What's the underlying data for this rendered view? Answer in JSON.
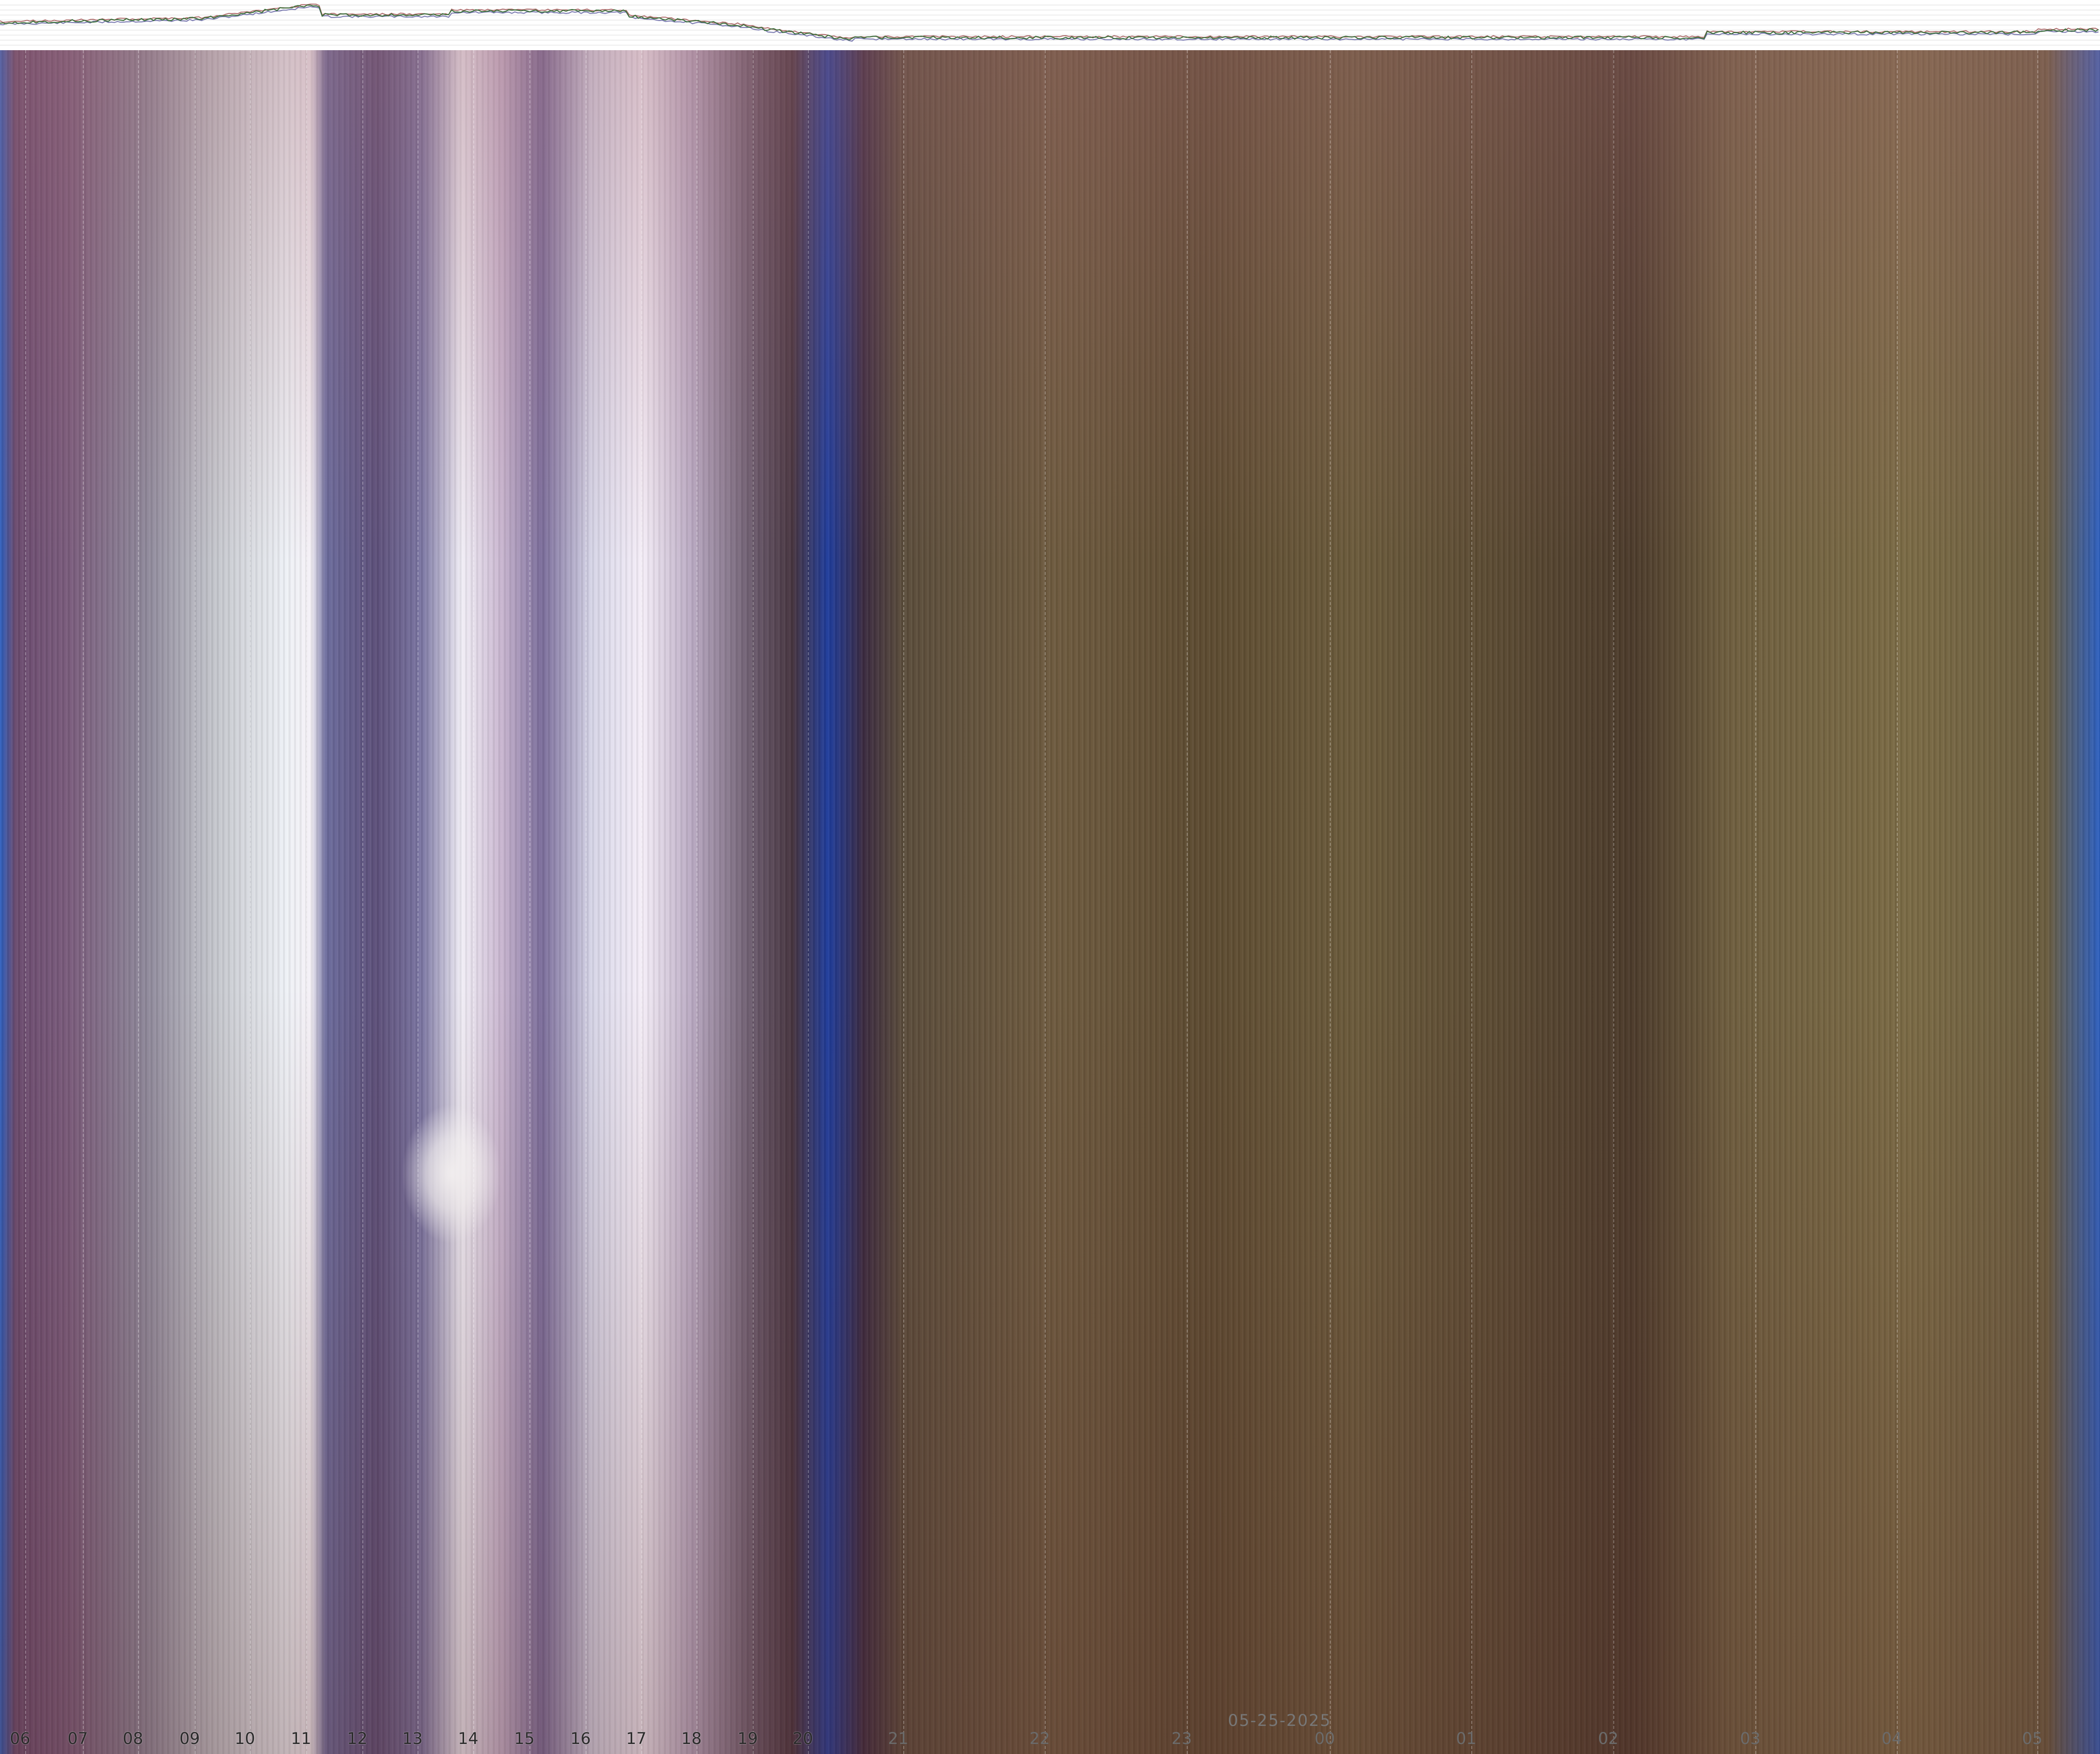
{
  "date_label": "05-25-2025",
  "hour_labels": [
    "06",
    "07",
    "08",
    "09",
    "10",
    "11",
    "12",
    "13",
    "14",
    "15",
    "16",
    "17",
    "18",
    "19",
    "20",
    "21",
    "22",
    "23",
    "00",
    "01",
    "02",
    "03",
    "04",
    "05"
  ],
  "hour_label_style": [
    "day",
    "day",
    "day",
    "day",
    "day",
    "day",
    "day",
    "day",
    "day",
    "day",
    "day",
    "day",
    "day",
    "day",
    "day",
    "night",
    "night",
    "night",
    "night",
    "night",
    "night",
    "night",
    "night",
    "night"
  ],
  "colors": {
    "sparkline_primary": "#3a6e3a",
    "sparkline_secondary": "#7a7ab0",
    "sparkline_tertiary": "#b07070",
    "grid": "#dddddd",
    "twilight_blue": "#2c5fc0"
  }
}
